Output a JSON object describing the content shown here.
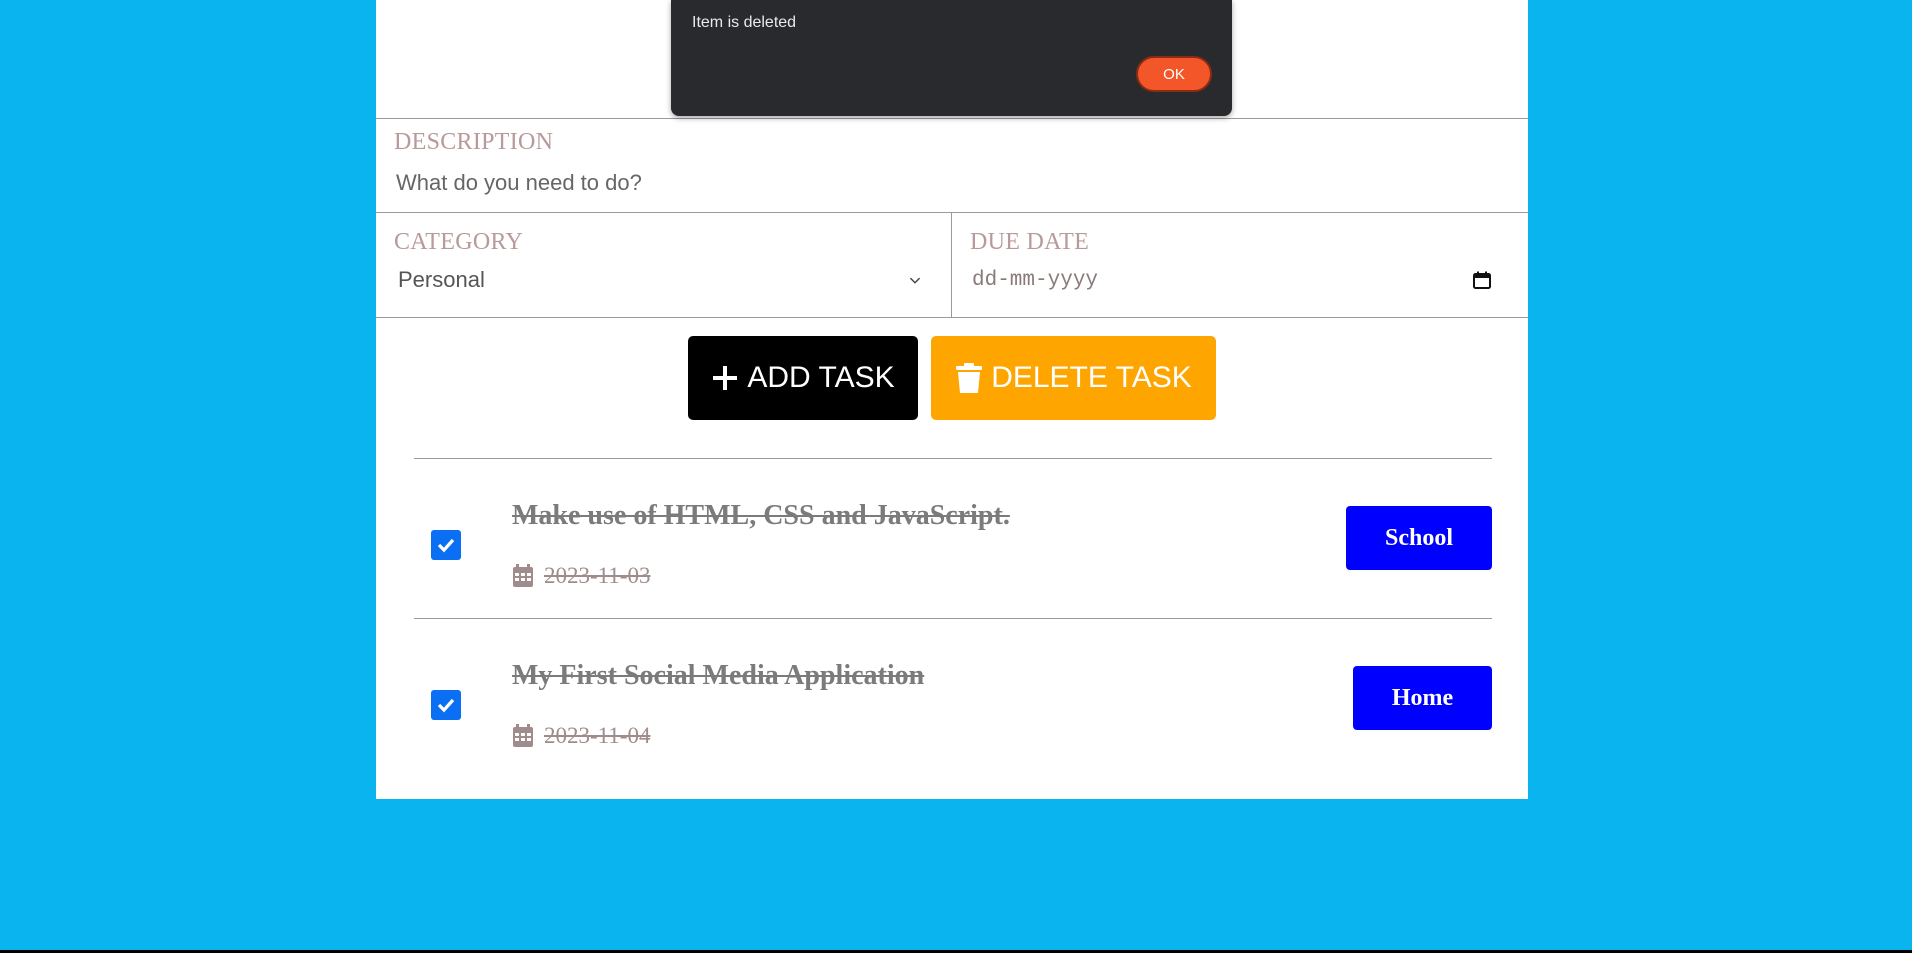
{
  "dialog": {
    "message": "Item is deleted",
    "ok_label": "OK"
  },
  "form": {
    "description_label": "DESCRIPTION",
    "description_placeholder": "What do you need to do?",
    "description_value": "",
    "category_label": "CATEGORY",
    "category_value": "Personal",
    "due_date_label": "DUE DATE",
    "due_date_placeholder": "dd-mm-yyyy"
  },
  "actions": {
    "add_label": "ADD TASK",
    "delete_label": "DELETE TASK"
  },
  "tasks": [
    {
      "title": "Make use of HTML, CSS and JavaScript.",
      "date": "2023-11-03",
      "category": "School",
      "checked": true
    },
    {
      "title": "My First Social Media Application",
      "date": "2023-11-04",
      "category": "Home",
      "checked": true
    }
  ],
  "colors": {
    "background": "#0ab4ef",
    "add_button": "#000000",
    "delete_button": "#ffa500",
    "badge": "#0000ff",
    "checkbox": "#0b6ff3",
    "dialog_ok": "#f35628"
  },
  "icons": {
    "add": "plus-icon",
    "delete": "trash-icon",
    "date": "calendar-icon",
    "select": "chevron-down-icon",
    "checkbox": "checkmark-icon"
  }
}
